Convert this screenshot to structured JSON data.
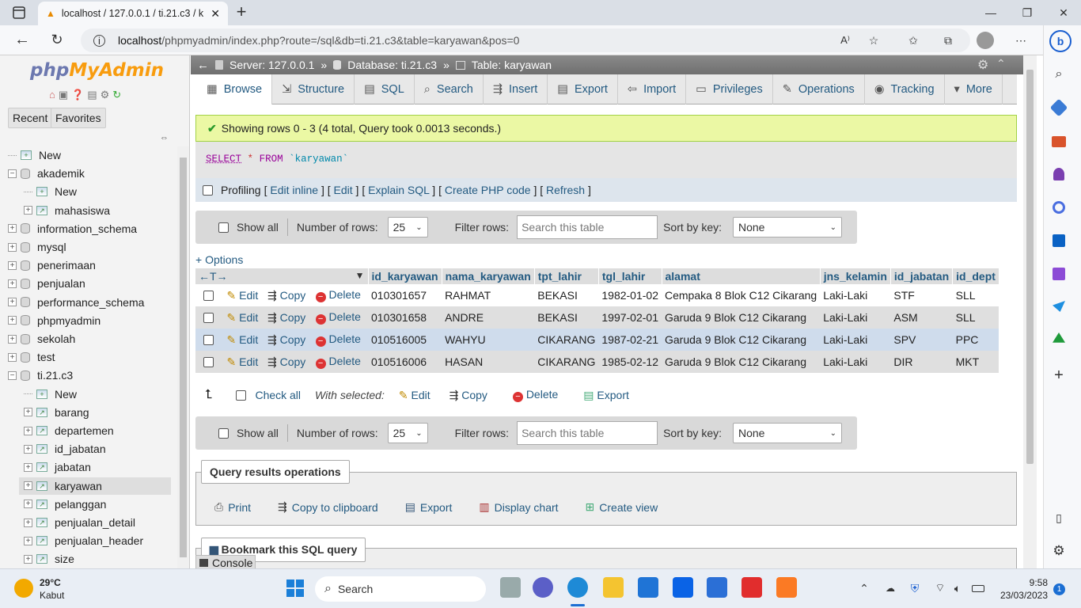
{
  "browser": {
    "tab_title": "localhost / 127.0.0.1 / ti.21.c3 / k",
    "new_tab_label": "+",
    "url_host": "localhost",
    "url_path": "/phpmyadmin/index.php?route=/sql&db=ti.21.c3&table=karyawan&pos=0"
  },
  "sidebar": {
    "logo_php": "php",
    "logo_my": "MyAdmin",
    "recent": "Recent",
    "favorites": "Favorites",
    "tree": [
      {
        "label": "New",
        "kind": "new",
        "level": 0
      },
      {
        "label": "akademik",
        "kind": "db",
        "level": 0,
        "sign": "−"
      },
      {
        "label": "New",
        "kind": "new",
        "level": 1
      },
      {
        "label": "mahasiswa",
        "kind": "table",
        "level": 1
      },
      {
        "label": "information_schema",
        "kind": "db",
        "level": 0,
        "sign": "+"
      },
      {
        "label": "mysql",
        "kind": "db",
        "level": 0,
        "sign": "+"
      },
      {
        "label": "penerimaan",
        "kind": "db",
        "level": 0,
        "sign": "+"
      },
      {
        "label": "penjualan",
        "kind": "db",
        "level": 0,
        "sign": "+"
      },
      {
        "label": "performance_schema",
        "kind": "db",
        "level": 0,
        "sign": "+"
      },
      {
        "label": "phpmyadmin",
        "kind": "db",
        "level": 0,
        "sign": "+"
      },
      {
        "label": "sekolah",
        "kind": "db",
        "level": 0,
        "sign": "+"
      },
      {
        "label": "test",
        "kind": "db",
        "level": 0,
        "sign": "+"
      },
      {
        "label": "ti.21.c3",
        "kind": "db",
        "level": 0,
        "sign": "−"
      },
      {
        "label": "New",
        "kind": "new",
        "level": 1
      },
      {
        "label": "barang",
        "kind": "table",
        "level": 1
      },
      {
        "label": "departemen",
        "kind": "table",
        "level": 1
      },
      {
        "label": "id_jabatan",
        "kind": "table",
        "level": 1
      },
      {
        "label": "jabatan",
        "kind": "table",
        "level": 1
      },
      {
        "label": "karyawan",
        "kind": "table",
        "level": 1,
        "selected": true
      },
      {
        "label": "pelanggan",
        "kind": "table",
        "level": 1
      },
      {
        "label": "penjualan_detail",
        "kind": "table",
        "level": 1
      },
      {
        "label": "penjualan_header",
        "kind": "table",
        "level": 1
      },
      {
        "label": "size",
        "kind": "table",
        "level": 1
      }
    ]
  },
  "breadcrumb": {
    "server": "Server: 127.0.0.1",
    "database": "Database: ti.21.c3",
    "table": "Table: karyawan",
    "sep": "»"
  },
  "tabs": [
    "Browse",
    "Structure",
    "SQL",
    "Search",
    "Insert",
    "Export",
    "Import",
    "Privileges",
    "Operations",
    "Tracking",
    "More"
  ],
  "message": "Showing rows 0 - 3 (4 total, Query took 0.0013 seconds.)",
  "sql": {
    "select": "SELECT",
    "star": "*",
    "from": "FROM",
    "table": "`karyawan`"
  },
  "profiling": {
    "label": "Profiling",
    "links": [
      "Edit inline",
      "Edit",
      "Explain SQL",
      "Create PHP code",
      "Refresh"
    ]
  },
  "nav": {
    "show_all": "Show all",
    "number_of_rows": "Number of rows:",
    "rows_value": "25",
    "filter_rows": "Filter rows:",
    "filter_placeholder": "Search this table",
    "sort_by_key": "Sort by key:",
    "sort_value": "None"
  },
  "options_link": "+ Options",
  "table": {
    "columns": [
      "id_karyawan",
      "nama_karyawan",
      "tpt_lahir",
      "tgl_lahir",
      "alamat",
      "jns_kelamin",
      "id_jabatan",
      "id_dept"
    ],
    "action_labels": {
      "edit": "Edit",
      "copy": "Copy",
      "delete": "Delete"
    },
    "rows": [
      [
        "010301657",
        "RAHMAT",
        "BEKASI",
        "1982-01-02",
        "Cempaka 8 Blok C12 Cikarang",
        "Laki-Laki",
        "STF",
        "SLL"
      ],
      [
        "010301658",
        "ANDRE",
        "BEKASI",
        "1997-02-01",
        "Garuda 9 Blok C12 Cikarang",
        "Laki-Laki",
        "ASM",
        "SLL"
      ],
      [
        "010516005",
        "WAHYU",
        "CIKARANG",
        "1987-02-21",
        "Garuda 9 Blok C12 Cikarang",
        "Laki-Laki",
        "SPV",
        "PPC"
      ],
      [
        "010516006",
        "HASAN",
        "CIKARANG",
        "1985-02-12",
        "Garuda 9 Blok C12 Cikarang",
        "Laki-Laki",
        "DIR",
        "MKT"
      ]
    ]
  },
  "bulk": {
    "check_all": "Check all",
    "with_selected": "With selected:",
    "edit": "Edit",
    "copy": "Copy",
    "delete": "Delete",
    "export": "Export"
  },
  "query_ops": {
    "legend": "Query results operations",
    "items": [
      "Print",
      "Copy to clipboard",
      "Export",
      "Display chart",
      "Create view"
    ]
  },
  "bookmark": "Bookmark this SQL query",
  "console": "Console",
  "taskbar": {
    "temp": "29°C",
    "weather": "Kabut",
    "search": "Search",
    "time": "9:58",
    "date": "23/03/2023",
    "notif_count": "1"
  }
}
